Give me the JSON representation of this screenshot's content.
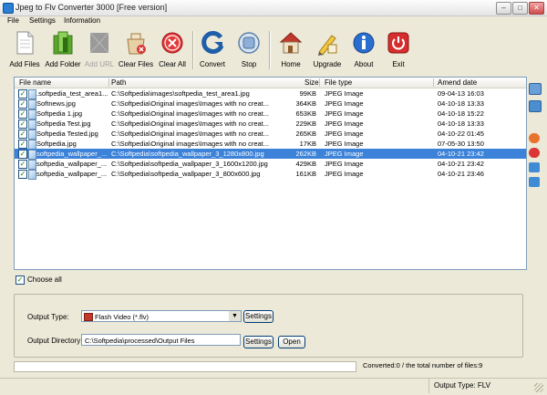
{
  "window": {
    "title": "Jpeg to Flv Converter 3000 [Free version]",
    "minimize_glyph": "–",
    "maximize_glyph": "□",
    "close_glyph": "✕"
  },
  "menu": [
    "File",
    "Settings",
    "Information"
  ],
  "toolbar": {
    "add_files": "Add Files",
    "add_folder": "Add Folder",
    "add_url": "Add URL",
    "clear_files": "Clear Files",
    "clear_all": "Clear All",
    "convert": "Convert",
    "stop": "Stop",
    "home": "Home",
    "upgrade": "Upgrade",
    "about": "About",
    "exit": "Exit"
  },
  "file_list": {
    "columns": [
      "File name",
      "Path",
      "Size",
      "File type",
      "Amend date"
    ],
    "rows": [
      {
        "name": ".softpedia_test_area1...",
        "path": "C:\\Softpedia\\images\\softpedia_test_area1.jpg",
        "size": "99KB",
        "type": "JPEG Image",
        "date": "09-04-13 16:03",
        "checked": true,
        "selected": false
      },
      {
        "name": "Softnews.jpg",
        "path": "C:\\Softpedia\\Original images\\Images with no creat...",
        "size": "364KB",
        "type": "JPEG Image",
        "date": "04-10-18 13:33",
        "checked": true,
        "selected": false
      },
      {
        "name": "Softpedia 1.jpg",
        "path": "C:\\Softpedia\\Original images\\Images with no creat...",
        "size": "653KB",
        "type": "JPEG Image",
        "date": "04-10-18 15:22",
        "checked": true,
        "selected": false
      },
      {
        "name": "Softpedia Test.jpg",
        "path": "C:\\Softpedia\\Original images\\Images with no creat...",
        "size": "229KB",
        "type": "JPEG Image",
        "date": "04-10-18 13:33",
        "checked": true,
        "selected": false
      },
      {
        "name": "Softpedia Tested.jpg",
        "path": "C:\\Softpedia\\Original images\\Images with no creat...",
        "size": "265KB",
        "type": "JPEG Image",
        "date": "04-10-22 01:45",
        "checked": true,
        "selected": false
      },
      {
        "name": "Softpedia.jpg",
        "path": "C:\\Softpedia\\Original images\\Images with no creat...",
        "size": "17KB",
        "type": "JPEG Image",
        "date": "07-05-30 13:50",
        "checked": true,
        "selected": false
      },
      {
        "name": "softpedia_wallpaper_...",
        "path": "C:\\Softpedia\\softpedia_wallpaper_3_1280x800.jpg",
        "size": "262KB",
        "type": "JPEG Image",
        "date": "04-10-21 23:42",
        "checked": true,
        "selected": true
      },
      {
        "name": "softpedia_wallpaper_...",
        "path": "C:\\Softpedia\\softpedia_wallpaper_3_1600x1200.jpg",
        "size": "429KB",
        "type": "JPEG Image",
        "date": "04-10-21 23:42",
        "checked": true,
        "selected": false
      },
      {
        "name": "softpedia_wallpaper_...",
        "path": "C:\\Softpedia\\softpedia_wallpaper_3_800x600.jpg",
        "size": "161KB",
        "type": "JPEG Image",
        "date": "04-10-21 23:46",
        "checked": true,
        "selected": false
      }
    ]
  },
  "choose_all": {
    "label": "Choose all",
    "checked": true
  },
  "output": {
    "type_label": "Output Type:",
    "type_value": "Flash Video (*.flv)",
    "type_settings": "Settings",
    "dir_label": "Output Directory:",
    "dir_value": "C:\\Softpedia\\processed\\Output Files",
    "dir_settings": "Settings",
    "open": "Open"
  },
  "progress": {
    "converted_text": "Converted:0  /  the total number of files:9",
    "fraction": 0
  },
  "status": {
    "output_type": "Output Type: FLV"
  },
  "colors": {
    "selection": "#3b82d8",
    "window_bg": "#ece9d8",
    "accent": "#1f5ea8"
  }
}
